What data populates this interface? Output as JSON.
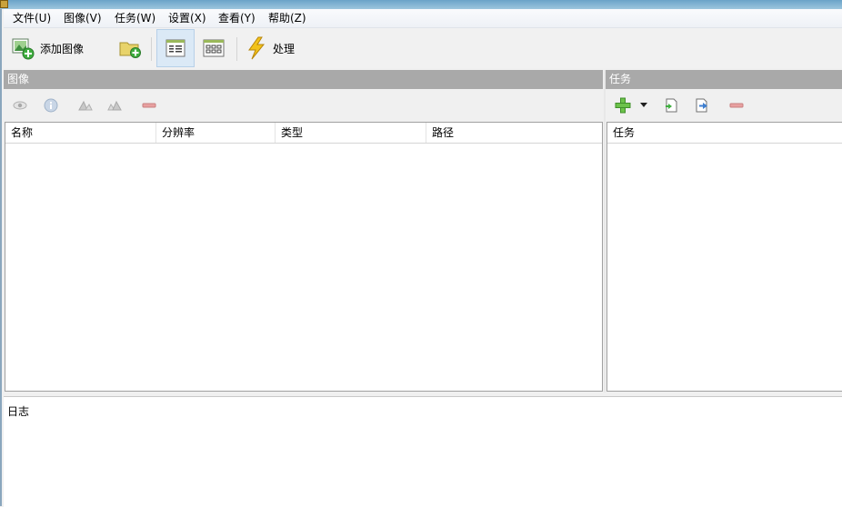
{
  "menu": [
    "文件(U)",
    "图像(V)",
    "任务(W)",
    "设置(X)",
    "查看(Y)",
    "帮助(Z)"
  ],
  "toolbar": {
    "add_image_label": "添加图像",
    "process_label": "处理"
  },
  "images_panel": {
    "title": "图像",
    "columns": [
      "名称",
      "分辨率",
      "类型",
      "路径"
    ]
  },
  "tasks_panel": {
    "title": "任务",
    "columns": [
      "任务"
    ]
  },
  "log_panel": {
    "title": "日志"
  },
  "colors": {
    "panel_header": "#a9a9a9",
    "active_view": "#dbe9f6",
    "title_bar": "#6aa3c8"
  }
}
